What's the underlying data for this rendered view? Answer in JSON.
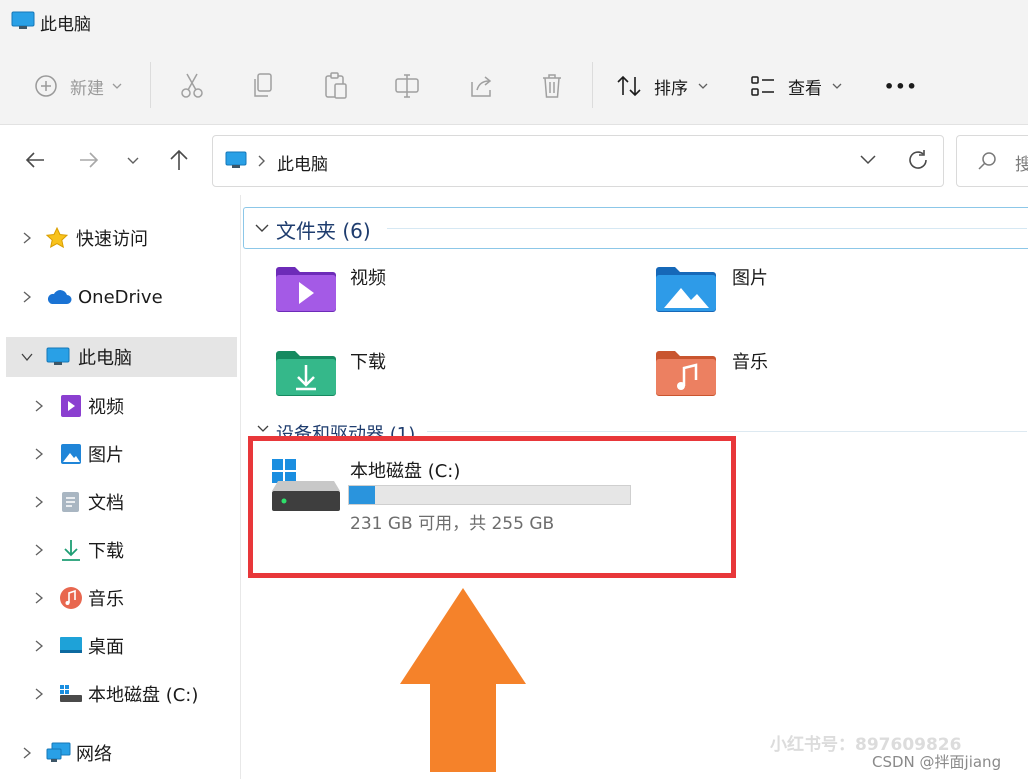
{
  "window": {
    "title": "此电脑"
  },
  "toolbar": {
    "new_label": "新建",
    "sort_label": "排序",
    "view_label": "查看",
    "more_label": "•••"
  },
  "address": {
    "breadcrumb": "此电脑",
    "search_placeholder": "搜"
  },
  "nav": {
    "items": [
      {
        "label": "快速访问"
      },
      {
        "label": "OneDrive"
      },
      {
        "label": "此电脑"
      },
      {
        "label": "视频"
      },
      {
        "label": "图片"
      },
      {
        "label": "文档"
      },
      {
        "label": "下载"
      },
      {
        "label": "音乐"
      },
      {
        "label": "桌面"
      },
      {
        "label": "本地磁盘 (C:)"
      },
      {
        "label": "网络"
      }
    ]
  },
  "content": {
    "folders_header": "文件夹 (6)",
    "folders": [
      {
        "label": "视频"
      },
      {
        "label": "图片"
      },
      {
        "label": "下载"
      },
      {
        "label": "音乐"
      }
    ],
    "devices_header": "设备和驱动器 (1)",
    "drive": {
      "name": "本地磁盘 (C:)",
      "free_text": "231 GB 可用，共 255 GB",
      "used_fraction": 0.094
    }
  },
  "watermark": {
    "xhs": "小红书号：897609826",
    "csdn": "CSDN @拌面jiang"
  },
  "colors": {
    "highlight_box": "#e8373a",
    "arrow": "#f5822a",
    "bar_fill": "#2a94dd"
  }
}
